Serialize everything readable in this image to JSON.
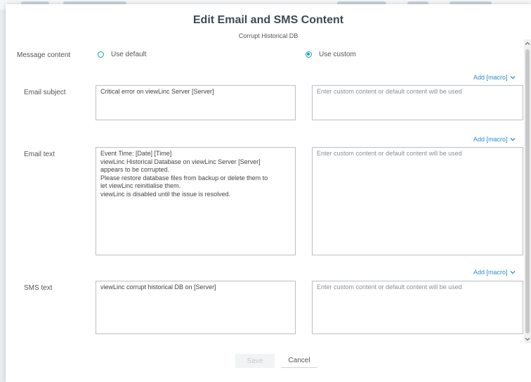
{
  "dialog": {
    "title": "Edit Email and SMS Content",
    "subtitle": "Corrupt Historical DB"
  },
  "message_content": {
    "label": "Message content",
    "options": [
      {
        "label": "Use default",
        "checked": false
      },
      {
        "label": "Use custom",
        "checked": true
      }
    ]
  },
  "add_macro_label": "Add [macro]",
  "placeholder": "Enter custom content or default content will be used",
  "email_subject": {
    "label": "Email subject",
    "default_value": "Critical error on viewLinc Server [Server]"
  },
  "email_text": {
    "label": "Email text",
    "default_lines": [
      "Event Time: [Date] [Time]",
      "viewLinc Historical Database on viewLinc Server [Server]",
      "appears to be corrupted.",
      "Please restore database files from backup or delete them to",
      "let viewLinc reinitialise them.",
      "viewLinc is disabled until the issue is resolved."
    ]
  },
  "sms_text": {
    "label": "SMS text",
    "default_value": "viewLinc corrupt historical DB on [Server]"
  },
  "buttons": {
    "save": "Save",
    "cancel": "Cancel"
  },
  "colors": {
    "accent": "#13a3b5",
    "link": "#2a8fc7",
    "title": "#3d4a57"
  }
}
